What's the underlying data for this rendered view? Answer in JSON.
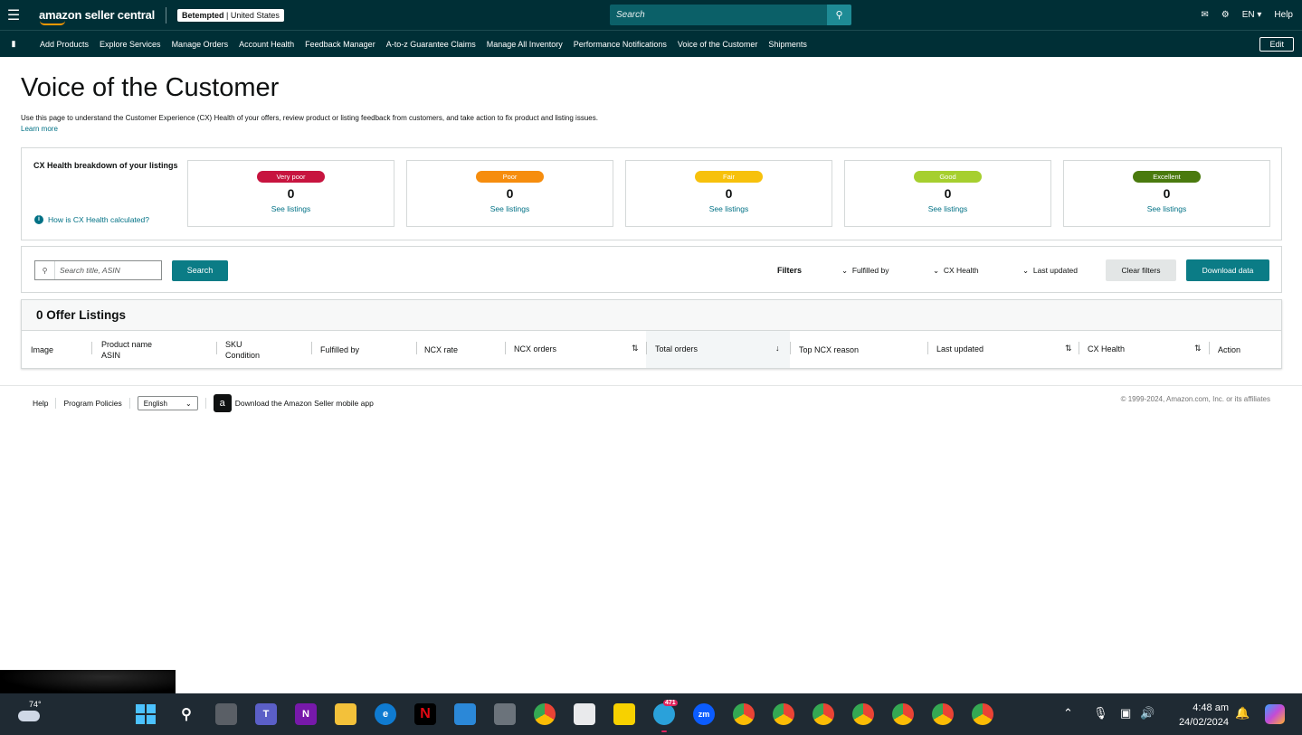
{
  "topbar": {
    "logo_text": "amazon seller central",
    "account_name": "Betempted",
    "account_region": "United States",
    "search_placeholder": "Search",
    "lang": "EN",
    "help": "Help"
  },
  "nav": {
    "items": [
      "Add Products",
      "Explore Services",
      "Manage Orders",
      "Account Health",
      "Feedback Manager",
      "A-to-z Guarantee Claims",
      "Manage All Inventory",
      "Performance Notifications",
      "Voice of the Customer",
      "Shipments"
    ],
    "edit": "Edit"
  },
  "page": {
    "title": "Voice of the Customer",
    "description": "Use this page to understand the Customer Experience (CX) Health of your offers, review product or listing feedback from customers, and take action to fix product and listing issues.",
    "learn_more": "Learn more"
  },
  "cx": {
    "label": "CX Health breakdown of your listings",
    "how_link": "How is CX Health calculated?",
    "cards": [
      {
        "label": "Very poor",
        "count": "0",
        "link": "See listings",
        "color": "#c7143f"
      },
      {
        "label": "Poor",
        "count": "0",
        "link": "See listings",
        "color": "#f68d0e"
      },
      {
        "label": "Fair",
        "count": "0",
        "link": "See listings",
        "color": "#f7c10c"
      },
      {
        "label": "Good",
        "count": "0",
        "link": "See listings",
        "color": "#a6cf2f"
      },
      {
        "label": "Excellent",
        "count": "0",
        "link": "See listings",
        "color": "#4a7a0e"
      }
    ]
  },
  "filters": {
    "search_placeholder": "Search title, ASIN",
    "search_button": "Search",
    "filters_label": "Filters",
    "fulfilled_by": "Fulfilled by",
    "cx_health": "CX Health",
    "last_updated": "Last updated",
    "clear": "Clear filters",
    "download": "Download data"
  },
  "table": {
    "title": "0 Offer Listings",
    "columns": {
      "image": "Image",
      "product_name": "Product name",
      "asin": "ASIN",
      "sku": "SKU",
      "condition": "Condition",
      "fulfilled_by": "Fulfilled by",
      "ncx_rate": "NCX rate",
      "ncx_orders": "NCX orders",
      "total_orders": "Total orders",
      "top_ncx_reason": "Top NCX reason",
      "last_updated": "Last updated",
      "cx_health": "CX Health",
      "action": "Action"
    }
  },
  "footer": {
    "help": "Help",
    "policies": "Program Policies",
    "language": "English",
    "app": "Download the Amazon Seller mobile app",
    "copyright": "© 1999-2024, Amazon.com, Inc. or its affiliates"
  },
  "taskbar": {
    "temp": "74°",
    "time": "4:48 am",
    "date": "24/02/2024",
    "telegram_badge": "471"
  }
}
